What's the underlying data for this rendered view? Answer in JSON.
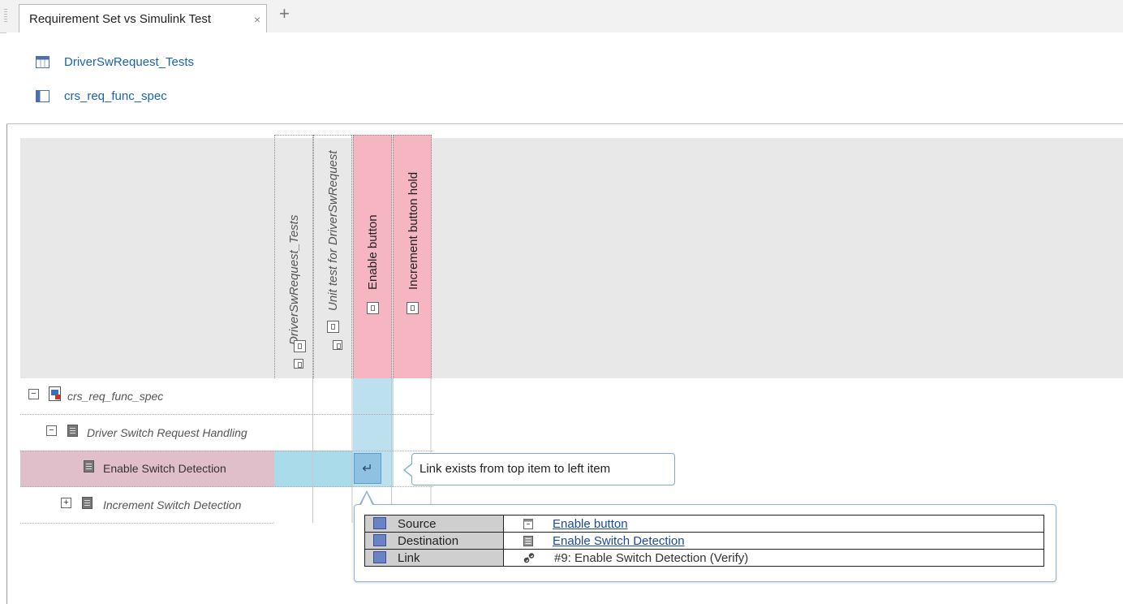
{
  "tabs": [
    {
      "label": "Requirement Set vs Simulink Test",
      "close": "×"
    }
  ],
  "tab_add": "+",
  "artifacts": [
    {
      "label": "DriverSwRequest_Tests",
      "icon": "test-file-icon"
    },
    {
      "label": "crs_req_func_spec",
      "icon": "req-set-icon"
    }
  ],
  "columns": [
    {
      "label": "DriverSwRequest_Tests",
      "italic": true,
      "highlight": false
    },
    {
      "label": "Unit test for DriverSwRequest",
      "italic": true,
      "highlight": false
    },
    {
      "label": "Enable button",
      "italic": false,
      "highlight": true
    },
    {
      "label": "Increment button hold",
      "italic": false,
      "highlight": true
    }
  ],
  "rows": [
    {
      "label": "crs_req_func_spec",
      "expander": "−",
      "italic": true
    },
    {
      "label": "Driver Switch Request Handling",
      "expander": "−",
      "italic": true
    },
    {
      "label": "Enable Switch Detection",
      "expander": "",
      "italic": false
    },
    {
      "label": "Increment Switch Detection",
      "expander": "+",
      "italic": true
    }
  ],
  "link_cell": {
    "icon": "↵"
  },
  "tooltip": {
    "text": "Link exists from top item to left item"
  },
  "details": [
    {
      "key": "Source",
      "value": "Enable button",
      "link": true
    },
    {
      "key": "Destination",
      "value": "Enable Switch Detection",
      "link": true
    },
    {
      "key": "Link",
      "value": "#9: Enable Switch Detection (Verify)",
      "link": false
    }
  ],
  "colors": {
    "accent": "#1a62b5",
    "pink": "#f5b6c2",
    "highlight": "#bde0ee"
  }
}
